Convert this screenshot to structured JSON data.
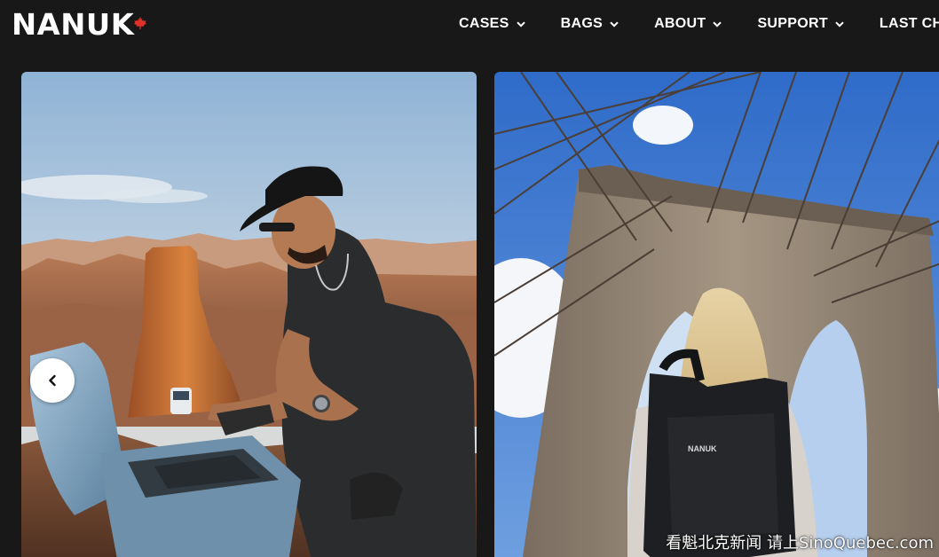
{
  "brand": {
    "logo_text": "NANUK",
    "flag_icon": "maple-leaf-icon",
    "flag_color": "#e0302a"
  },
  "nav": {
    "items": [
      {
        "label": "CASES",
        "icon": "chevron-down-icon"
      },
      {
        "label": "BAGS",
        "icon": "chevron-down-icon"
      },
      {
        "label": "ABOUT",
        "icon": "chevron-down-icon"
      },
      {
        "label": "SUPPORT",
        "icon": "chevron-down-icon"
      },
      {
        "label": "LAST CH",
        "icon": "chevron-down-icon"
      }
    ]
  },
  "carousel": {
    "prev_icon": "chevron-left-icon",
    "slides": [
      {
        "image": "man-drone-canyon-photo",
        "case_label": ""
      },
      {
        "image": "woman-backpack-bridge-photo",
        "backpack_label": "NANUK"
      }
    ]
  },
  "watermark": {
    "text": "看魁北克新闻 请上SinoQuebec.com"
  },
  "colors": {
    "background": "#181818",
    "nav_text": "#ffffff"
  }
}
